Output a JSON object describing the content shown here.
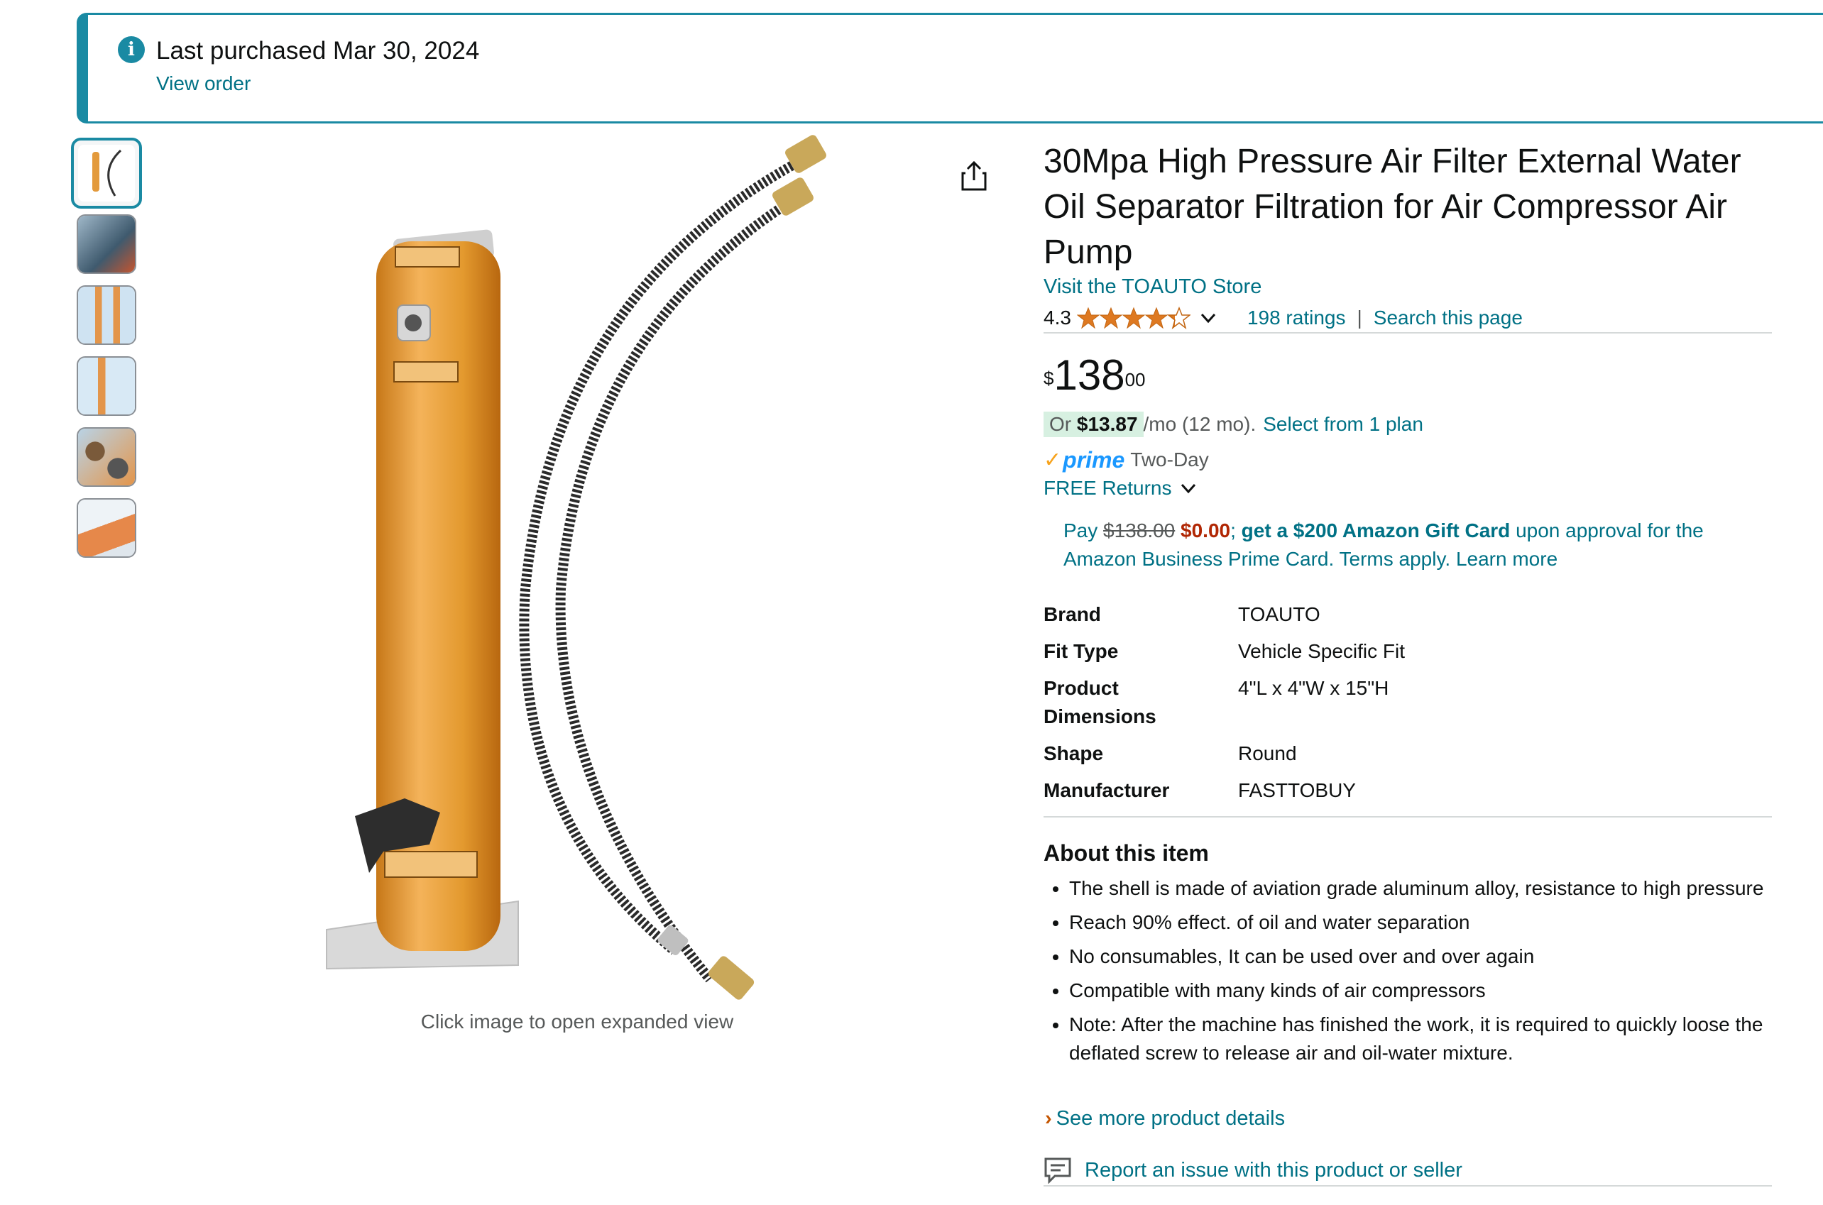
{
  "banner": {
    "title": "Last purchased Mar 30, 2024",
    "link": "View order",
    "accent": "#1a8aa3"
  },
  "gallery": {
    "thumbnails": [
      "thumbnail-1",
      "thumbnail-2",
      "thumbnail-3",
      "thumbnail-4",
      "thumbnail-5",
      "thumbnail-6"
    ],
    "caption": "Click image to open expanded view"
  },
  "product": {
    "title": "30Mpa High Pressure Air Filter External Water Oil Separator Filtration for Air Compressor Air Pump",
    "store_link": "Visit the TOAUTO Store",
    "rating": "4.3",
    "rating_value": 4.3,
    "ratings_count": "198 ratings",
    "separator": "|",
    "search_link": "Search this page",
    "price_symbol": "$",
    "price_whole": "138",
    "price_cents": "00",
    "monthly_prefix": "Or",
    "monthly_amount": "$13.87",
    "monthly_suffix": "/mo (12 mo).",
    "plan_link": "Select from 1 plan",
    "prime_label": "prime",
    "prime_delivery": "Two-Day",
    "returns": "FREE Returns",
    "promo": {
      "pay": "Pay",
      "old_price": "$138.00",
      "new_price": "$0.00",
      "semicolon": ";",
      "gift": "get a $200 Amazon Gift Card",
      "rest": "upon approval for the Amazon Business Prime Card. Terms apply.",
      "learn_more": "Learn more"
    },
    "specs": [
      {
        "key": "Brand",
        "value": "TOAUTO"
      },
      {
        "key": "Fit Type",
        "value": "Vehicle Specific Fit"
      },
      {
        "key": "Product Dimensions",
        "value": "4\"L x 4\"W x 15\"H"
      },
      {
        "key": "Shape",
        "value": "Round"
      },
      {
        "key": "Manufacturer",
        "value": "FASTTOBUY"
      }
    ],
    "about_heading": "About this item",
    "bullets": [
      "The shell is made of aviation grade aluminum alloy, resistance to high pressure",
      "Reach 90% effect. of oil and water separation",
      "No consumables, It can be used over and over again",
      "Compatible with many kinds of air compressors",
      "Note: After the machine has finished the work, it is required to quickly loose the deflated screw to release air and oil-water mixture."
    ],
    "see_more": "See more product details",
    "report": "Report an issue with this product or seller"
  },
  "colors": {
    "link": "#007185",
    "star": "#de7921",
    "prime": "#1a98ff",
    "deal_red": "#b12704"
  }
}
